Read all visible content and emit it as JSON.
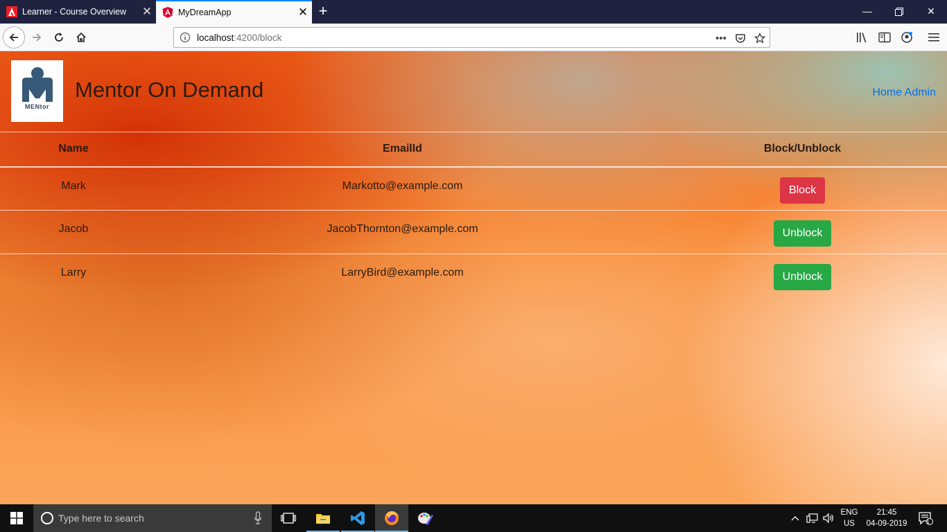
{
  "browser": {
    "tabs": [
      {
        "label": "Learner - Course Overview",
        "active": false,
        "icon": "adobe-icon"
      },
      {
        "label": "MyDreamApp",
        "active": true,
        "icon": "angular-icon"
      }
    ],
    "url": {
      "host": "localhost",
      "path": ":4200/block"
    }
  },
  "app": {
    "logo_text": "MENtor",
    "title": "Mentor On Demand",
    "nav": {
      "home": "Home",
      "admin": "Admin"
    }
  },
  "table": {
    "headers": [
      "Name",
      "EmailId",
      "Block/Unblock"
    ],
    "rows": [
      {
        "name": "Mark",
        "email": "Markotto@example.com",
        "action": "Block",
        "action_color": "#dc3545"
      },
      {
        "name": "Jacob",
        "email": "JacobThornton@example.com",
        "action": "Unblock",
        "action_color": "#28a745"
      },
      {
        "name": "Larry",
        "email": "LarryBird@example.com",
        "action": "Unblock",
        "action_color": "#28a745"
      }
    ]
  },
  "taskbar": {
    "search_placeholder": "Type here to search",
    "language": {
      "line1": "ENG",
      "line2": "US"
    },
    "clock": {
      "time": "21:45",
      "date": "04-09-2019"
    },
    "notifications": "1"
  }
}
